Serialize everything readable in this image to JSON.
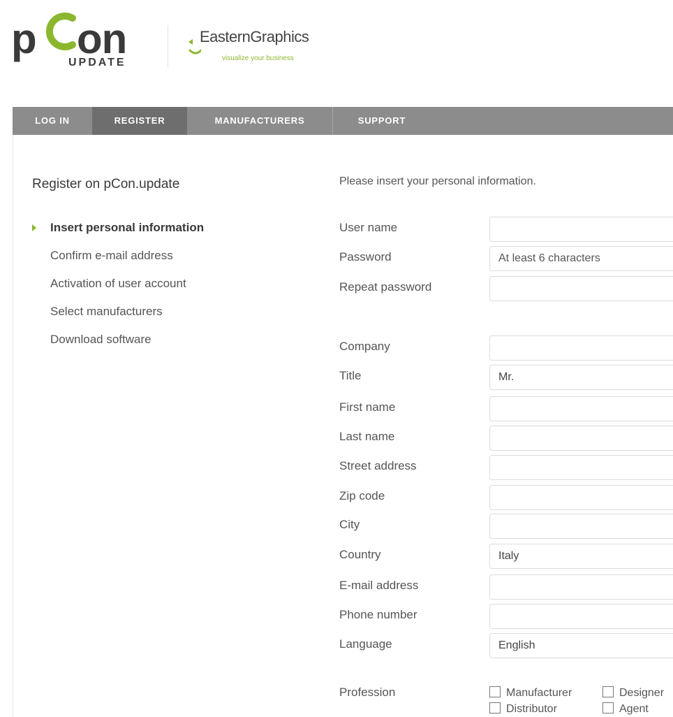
{
  "brand": {
    "product_name": "pCon",
    "product_sub": "UPDATE",
    "company": "EasternGraphics",
    "tagline": "visualize your business",
    "accent_color": "#8bb72e"
  },
  "nav": {
    "items": [
      {
        "label": "LOG IN"
      },
      {
        "label": "REGISTER"
      },
      {
        "label": "MANUFACTURERS"
      },
      {
        "label": "SUPPORT"
      }
    ],
    "active": "REGISTER"
  },
  "sidebar": {
    "title": "Register on pCon.update",
    "steps": [
      {
        "label": "Insert personal information"
      },
      {
        "label": "Confirm e-mail address"
      },
      {
        "label": "Activation of user account"
      },
      {
        "label": "Select manufacturers"
      },
      {
        "label": "Download software"
      }
    ]
  },
  "form": {
    "intro": "Please insert your personal information.",
    "username": {
      "label": "User name",
      "value": ""
    },
    "password": {
      "label": "Password",
      "placeholder": "At least 6 characters"
    },
    "repeat_password": {
      "label": "Repeat password",
      "value": ""
    },
    "company": {
      "label": "Company",
      "value": ""
    },
    "title": {
      "label": "Title",
      "value": "Mr."
    },
    "first_name": {
      "label": "First name",
      "value": ""
    },
    "last_name": {
      "label": "Last name",
      "value": ""
    },
    "street": {
      "label": "Street address",
      "value": ""
    },
    "zip": {
      "label": "Zip code",
      "value": ""
    },
    "city": {
      "label": "City",
      "value": ""
    },
    "country": {
      "label": "Country",
      "value": "Italy"
    },
    "email": {
      "label": "E-mail address",
      "value": ""
    },
    "phone": {
      "label": "Phone number",
      "value": ""
    },
    "language": {
      "label": "Language",
      "value": "English"
    },
    "profession": {
      "label": "Profession",
      "options": [
        {
          "label": "Manufacturer"
        },
        {
          "label": "Designer"
        },
        {
          "label": "Distributor"
        },
        {
          "label": "Agent"
        }
      ]
    }
  }
}
